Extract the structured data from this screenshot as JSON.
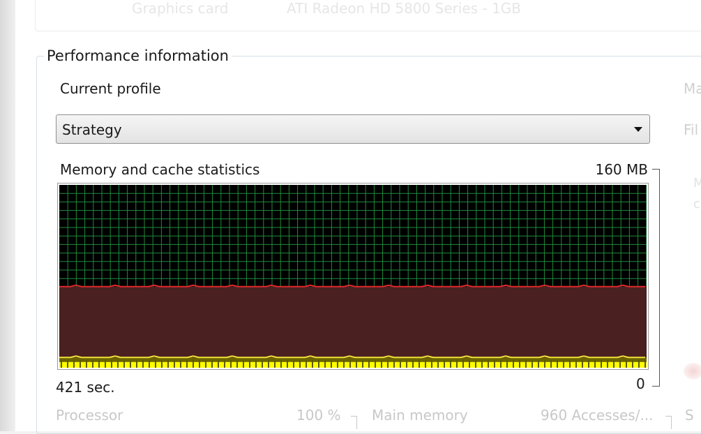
{
  "top_row": {
    "label": "Graphics card",
    "value": "ATI Radeon HD 5800 Series - 1GB"
  },
  "performance": {
    "group_title": "Performance information",
    "current_profile_label": "Current profile",
    "profile_value": "Strategy",
    "memory_title": "Memory and cache statistics",
    "max_label": "160 MB",
    "min_label": "0",
    "time_label": "421 sec."
  },
  "bottom": {
    "processor_label": "Processor",
    "processor_value": "100 %",
    "main_memory_label": "Main memory",
    "main_memory_value": "960 Accesses/...",
    "cut_label": "S"
  },
  "right_faded": {
    "a": "Ma",
    "b": "Fil",
    "c": "M",
    "d": "c"
  },
  "chart_data": {
    "type": "area",
    "x_label": "421 sec.",
    "ylim": [
      0,
      160
    ],
    "y_unit": "MB",
    "series": [
      {
        "color": "#4a2020",
        "line_color": "#e0282c",
        "level": 71
      },
      {
        "color": "#6b6400",
        "line_color": "#f2e23a",
        "level": 9
      },
      {
        "color": "#ffff00",
        "level": 5
      }
    ],
    "colors": {
      "background": "#000000",
      "grid": "#1f8c3c"
    }
  }
}
